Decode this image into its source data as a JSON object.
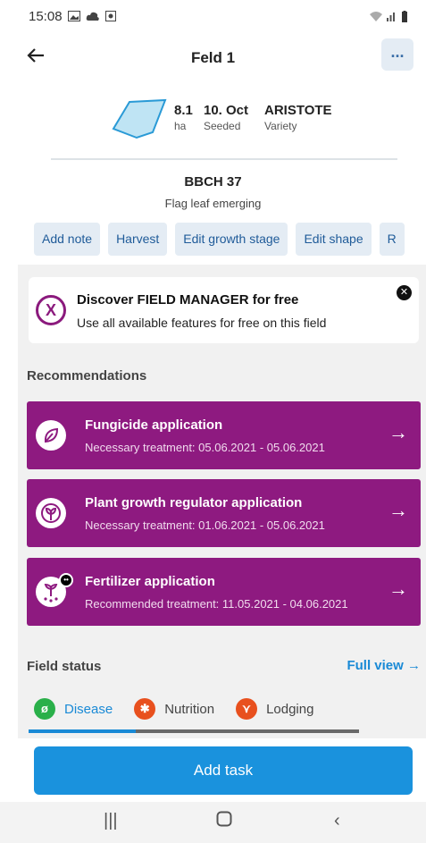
{
  "status_bar": {
    "time": "15:08"
  },
  "header": {
    "back_icon": "arrow-left-icon",
    "title": "Feld 1",
    "more_label": "..."
  },
  "field": {
    "area_value": "8.1",
    "area_unit": "ha",
    "date_value": "10. Oct",
    "date_label": "Seeded",
    "variety_value": "ARISTOTE",
    "variety_label": "Variety"
  },
  "growth": {
    "stage": "BBCH  37",
    "description": "Flag leaf emerging"
  },
  "actions": [
    "Add note",
    "Harvest",
    "Edit growth stage",
    "Edit shape",
    "R"
  ],
  "promo": {
    "title": "Discover FIELD MANAGER for free",
    "subtitle": "Use all available features for free on this field"
  },
  "recommendations_title": "Recommendations",
  "recommendations": [
    {
      "title": "Fungicide application",
      "subtitle": "Necessary treatment: 05.06.2021 - 05.06.2021",
      "icon": "leaf-icon"
    },
    {
      "title": "Plant growth regulator application",
      "subtitle": "Necessary treatment: 01.06.2021 - 05.06.2021",
      "icon": "plant-icon"
    },
    {
      "title": "Fertilizer application",
      "subtitle": "Recommended treatment: 11.05.2021 - 04.06.2021",
      "icon": "fertilizer-icon"
    }
  ],
  "field_status": {
    "title": "Field status",
    "full_view": "Full view",
    "tabs": [
      {
        "label": "Disease",
        "color": "#2ab04a"
      },
      {
        "label": "Nutrition",
        "color": "#e8501e"
      },
      {
        "label": "Lodging",
        "color": "#e8501e"
      }
    ]
  },
  "add_task_label": "Add task",
  "colors": {
    "accent": "#1a92dd",
    "recommendation": "#8e1a80"
  }
}
